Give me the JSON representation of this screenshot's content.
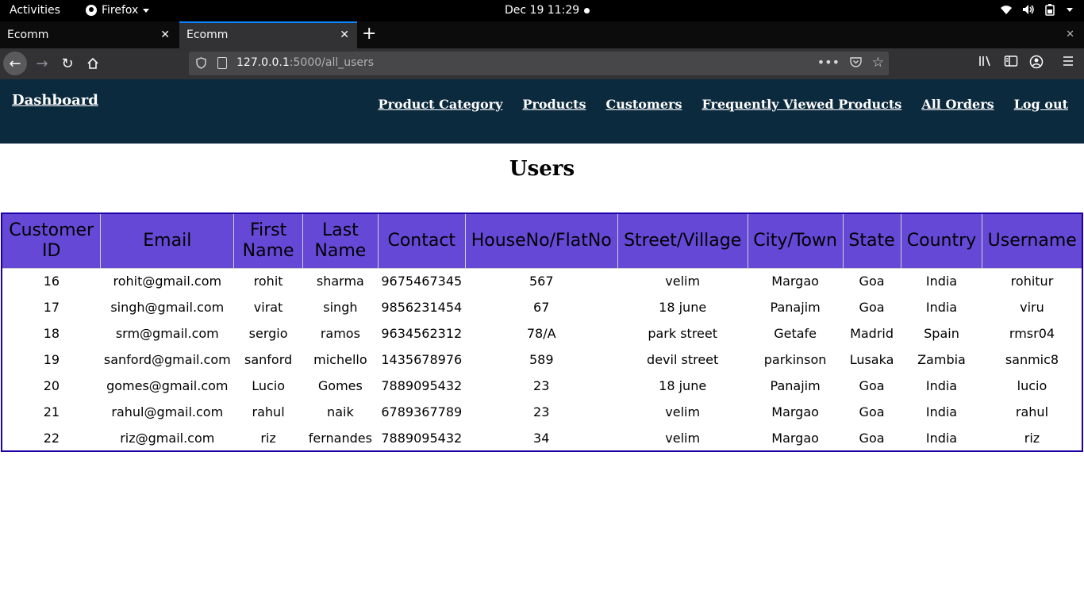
{
  "system_bar": {
    "activities": "Activities",
    "app_name": "Firefox",
    "clock": "Dec 19  11:29"
  },
  "browser": {
    "tabs": [
      {
        "title": "Ecomm",
        "active": false
      },
      {
        "title": "Ecomm",
        "active": true
      }
    ],
    "url_host": "127.0.0.1",
    "url_path": ":5000/all_users"
  },
  "app_header": {
    "brand": "Dashboard",
    "links": [
      "Product Category",
      "Products",
      "Customers",
      "Frequently Viewed Products",
      "All Orders",
      "Log out"
    ]
  },
  "page": {
    "title": "Users"
  },
  "table": {
    "headers": [
      "Customer ID",
      "Email",
      "First Name",
      "Last Name",
      "Contact",
      "HouseNo/FlatNo",
      "Street/Village",
      "City/Town",
      "State",
      "Country",
      "Username"
    ],
    "rows": [
      [
        "16",
        "rohit@gmail.com",
        "rohit",
        "sharma",
        "9675467345",
        "567",
        "velim",
        "Margao",
        "Goa",
        "India",
        "rohitur"
      ],
      [
        "17",
        "singh@gmail.com",
        "virat",
        "singh",
        "9856231454",
        "67",
        "18 june",
        "Panajim",
        "Goa",
        "India",
        "viru"
      ],
      [
        "18",
        "srm@gmail.com",
        "sergio",
        "ramos",
        "9634562312",
        "78/A",
        "park street",
        "Getafe",
        "Madrid",
        "Spain",
        "rmsr04"
      ],
      [
        "19",
        "sanford@gmail.com",
        "sanford",
        "michello",
        "1435678976",
        "589",
        "devil street",
        "parkinson",
        "Lusaka",
        "Zambia",
        "sanmic8"
      ],
      [
        "20",
        "gomes@gmail.com",
        "Lucio",
        "Gomes",
        "7889095432",
        "23",
        "18 june",
        "Panajim",
        "Goa",
        "India",
        "lucio"
      ],
      [
        "21",
        "rahul@gmail.com",
        "rahul",
        "naik",
        "6789367789",
        "23",
        "velim",
        "Margao",
        "Goa",
        "India",
        "rahul"
      ],
      [
        "22",
        "riz@gmail.com",
        "riz",
        "fernandes",
        "7889095432",
        "34",
        "velim",
        "Margao",
        "Goa",
        "India",
        "riz"
      ]
    ]
  },
  "colors": {
    "header_bg": "#0c2a3e",
    "table_header_bg": "#6548d6",
    "table_border": "#1d00a8",
    "tab_accent": "#0a84ff"
  }
}
